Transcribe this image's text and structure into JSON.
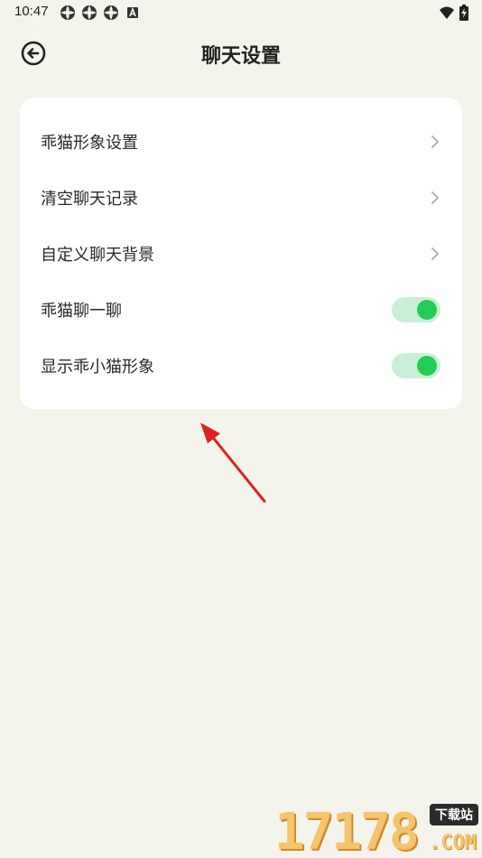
{
  "status_bar": {
    "time": "10:47",
    "left_icons": [
      "app-notification-icon",
      "app-notification-icon",
      "app-notification-icon",
      "a-badge-icon"
    ],
    "right_icons": [
      "wifi-icon",
      "battery-charging-icon"
    ]
  },
  "header": {
    "title": "聊天设置",
    "back_icon": "back-circle-arrow-icon"
  },
  "settings": {
    "items": [
      {
        "label": "乖猫形象设置",
        "control": "chevron"
      },
      {
        "label": "清空聊天记录",
        "control": "chevron"
      },
      {
        "label": "自定义聊天背景",
        "control": "chevron"
      },
      {
        "label": "乖猫聊一聊",
        "control": "toggle",
        "on": true
      },
      {
        "label": "显示乖小猫形象",
        "control": "toggle",
        "on": true
      }
    ]
  },
  "colors": {
    "background": "#f4f4ec",
    "card": "#ffffff",
    "toggle_track": "#c9efd6",
    "toggle_knob": "#22cc55",
    "annotation_arrow": "#dd2222"
  },
  "watermark": {
    "digits": "17178",
    "badge": "下载站",
    "suffix": ".COM"
  }
}
